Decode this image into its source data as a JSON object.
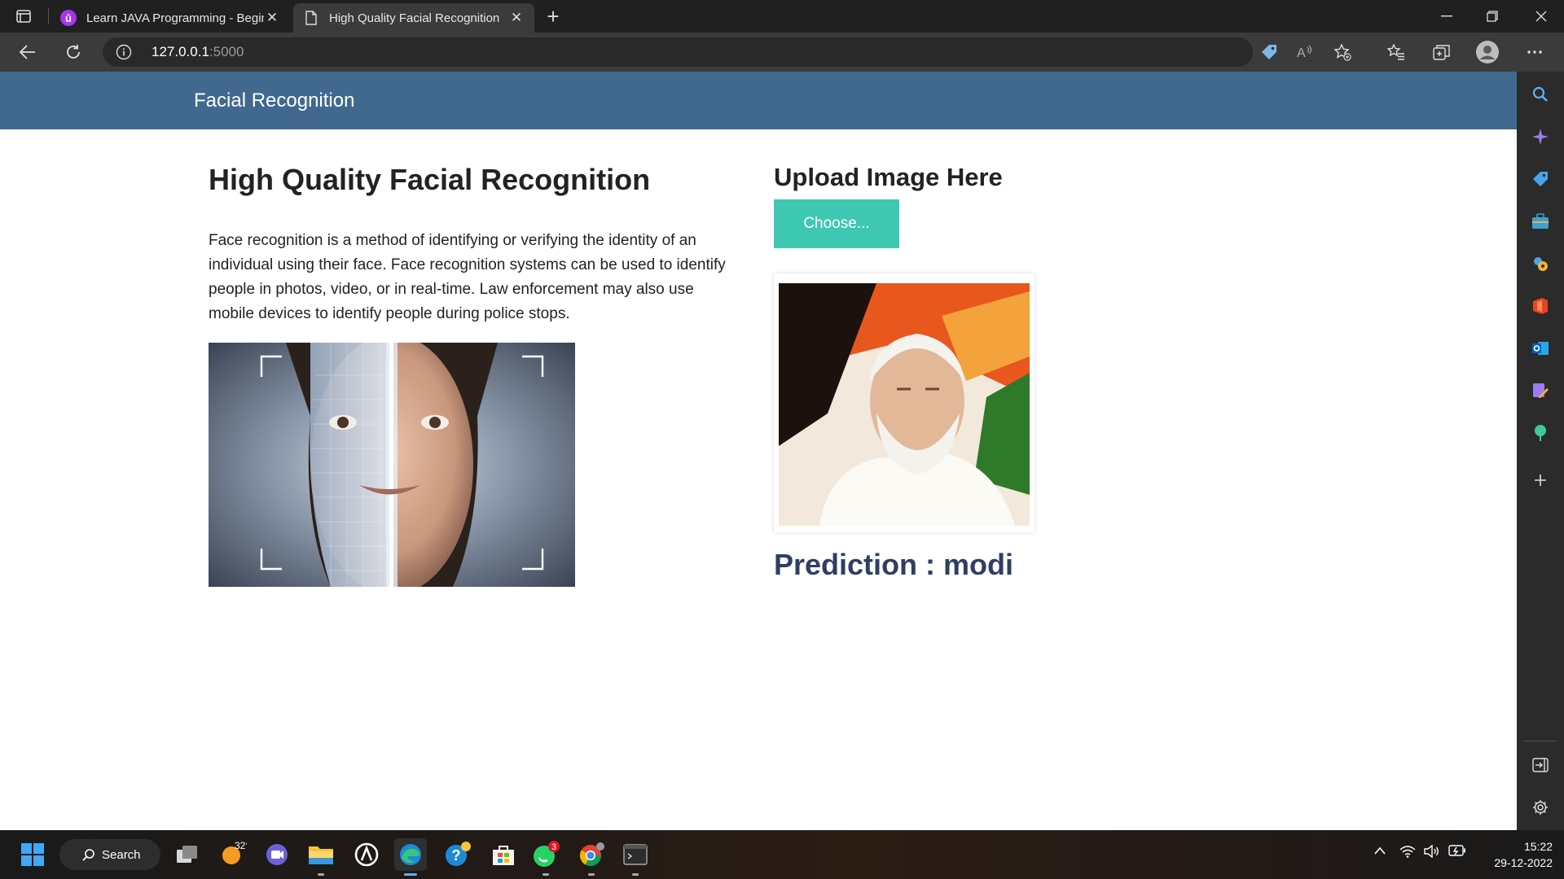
{
  "browser": {
    "tabs": [
      {
        "title": "Learn JAVA Programming - Begin",
        "active": false
      },
      {
        "title": "High Quality Facial Recognition",
        "active": true
      }
    ],
    "address": {
      "host": "127.0.0.1",
      "port": ":5000"
    }
  },
  "page": {
    "brand": "Facial Recognition",
    "heading": "High Quality Facial Recognition",
    "description": "Face recognition is a method of identifying or verifying the identity of an individual using their face. Face recognition systems can be used to identify people in photos, video, or in real-time. Law enforcement may also use mobile devices to identify people during police stops.",
    "upload_heading": "Upload Image Here",
    "choose_button": "Choose...",
    "prediction": "Prediction : modi"
  },
  "colors": {
    "navbar": "#41698f",
    "choose_button": "#3ec8b2",
    "prediction_text": "#2f3e63"
  },
  "taskbar": {
    "search_label": "Search",
    "weather_temp": "32°",
    "whatsapp_badge": "3",
    "time": "15:22",
    "date": "29-12-2022"
  }
}
